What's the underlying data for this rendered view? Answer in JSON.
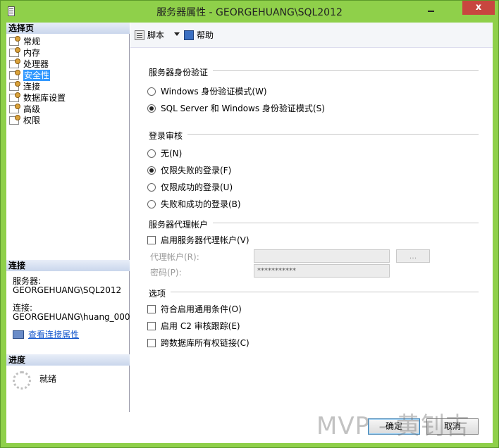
{
  "window": {
    "title": "服务器属性 - GEORGEHUANG\\SQL2012",
    "close_glyph": "x"
  },
  "left": {
    "select_page_header": "选择页",
    "pages": [
      {
        "label": "常规"
      },
      {
        "label": "内存"
      },
      {
        "label": "处理器"
      },
      {
        "label": "安全性",
        "selected": true
      },
      {
        "label": "连接"
      },
      {
        "label": "数据库设置"
      },
      {
        "label": "高级"
      },
      {
        "label": "权限"
      }
    ],
    "connection_header": "连接",
    "server_label": "服务器:",
    "server_value": "GEORGEHUANG\\SQL2012",
    "conn_label": "连接:",
    "conn_value": "GEORGEHUANG\\huang_000",
    "view_conn_link": "查看连接属性",
    "progress_header": "进度",
    "progress_status": "就绪"
  },
  "toolbar": {
    "script_label": "脚本",
    "help_label": "帮助"
  },
  "auth": {
    "title": "服务器身份验证",
    "options": [
      {
        "label": "Windows 身份验证模式(W)",
        "selected": false
      },
      {
        "label": "SQL Server 和 Windows 身份验证模式(S)",
        "selected": true
      }
    ]
  },
  "audit": {
    "title": "登录审核",
    "options": [
      {
        "label": "无(N)",
        "selected": false
      },
      {
        "label": "仅限失败的登录(F)",
        "selected": true
      },
      {
        "label": "仅限成功的登录(U)",
        "selected": false
      },
      {
        "label": "失败和成功的登录(B)",
        "selected": false
      }
    ]
  },
  "proxy": {
    "title": "服务器代理帐户",
    "enable_label": "启用服务器代理帐户(V)",
    "enabled": false,
    "account_label": "代理帐户(R):",
    "account_value": "",
    "browse_label": "...",
    "password_label": "密码(P):",
    "password_value": "***********"
  },
  "options": {
    "title": "选项",
    "items": [
      {
        "label": "符合启用通用条件(O)",
        "checked": false
      },
      {
        "label": "启用 C2 审核跟踪(E)",
        "checked": false
      },
      {
        "label": "跨数据库所有权链接(C)",
        "checked": false
      }
    ]
  },
  "buttons": {
    "ok": "确定",
    "cancel": "取消"
  },
  "watermark": "MVP - 黄钊吉",
  "colors": {
    "titlebar": "#8fd04a",
    "close_button": "#c8463f",
    "selection": "#3399ff",
    "link": "#1155cc"
  }
}
